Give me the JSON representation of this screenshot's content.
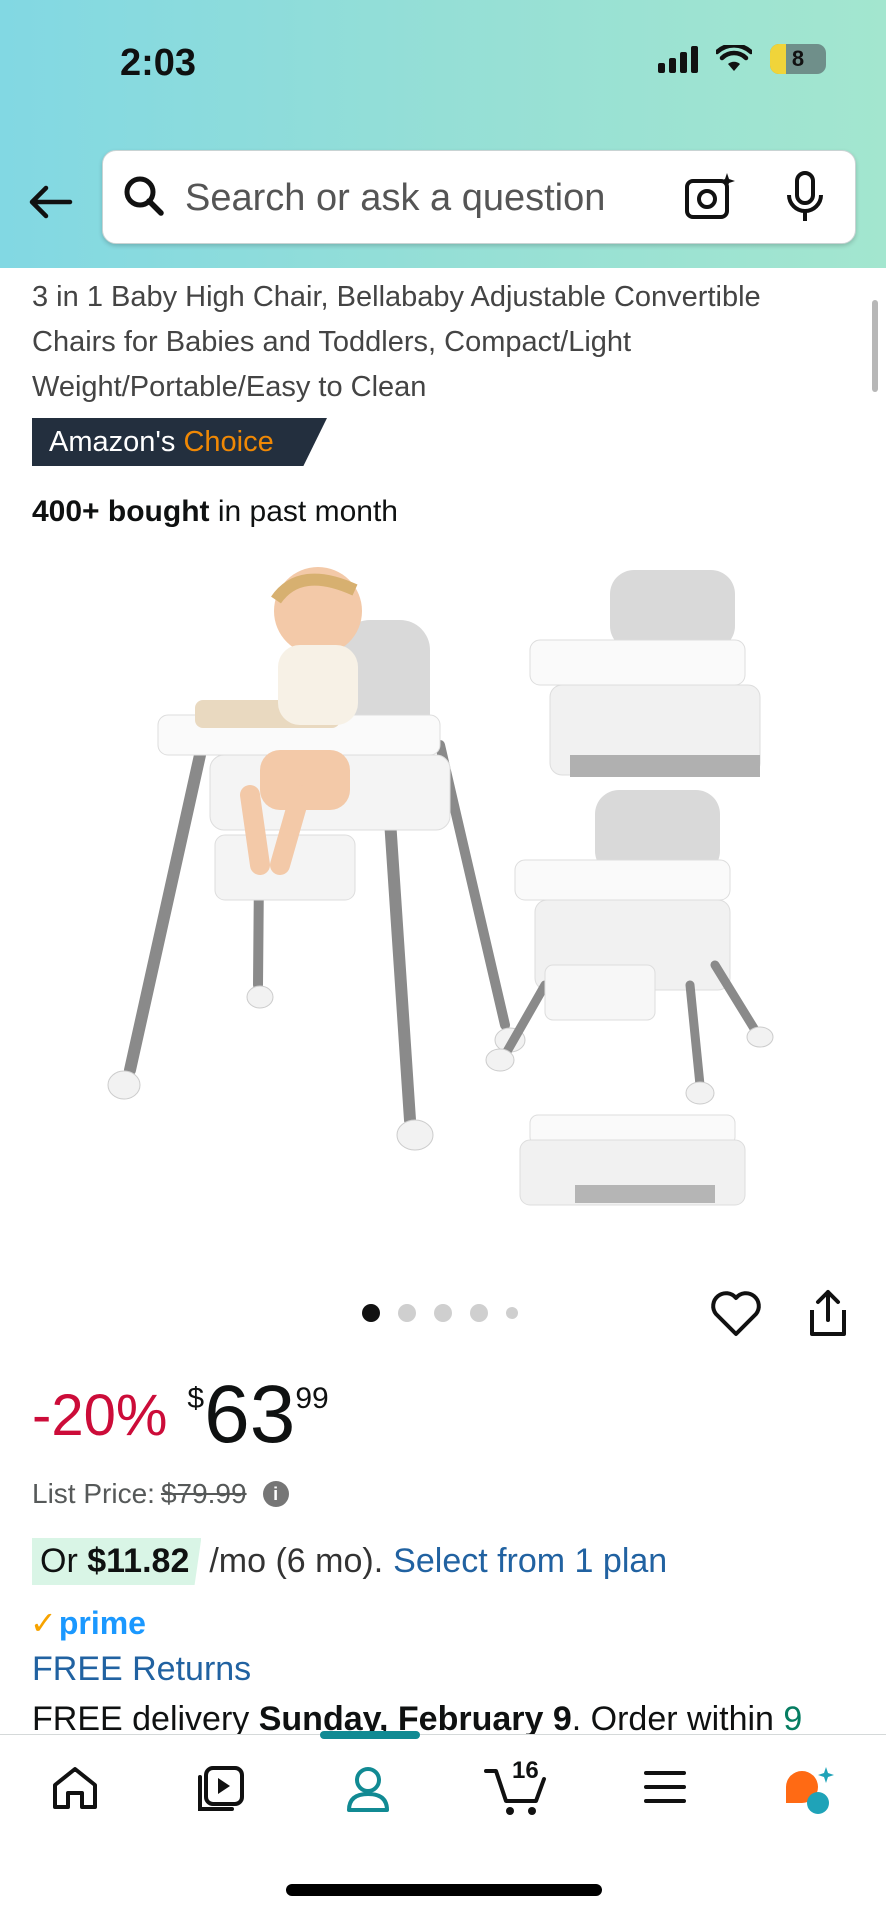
{
  "status_bar": {
    "time": "2:03",
    "battery": "8"
  },
  "search": {
    "placeholder": "Search or ask a question"
  },
  "product": {
    "title": "3 in 1 Baby High Chair, Bellababy Adjustable Convertible Chairs for Babies and Toddlers, Compact/Light Weight/Portable/Easy to Clean",
    "badge_prefix": "Amazon's",
    "badge_choice": "Choice",
    "bought_bold": "400+ bought",
    "bought_rest": "in past month",
    "gallery_dots": 5,
    "gallery_active": 1
  },
  "price": {
    "discount": "-20%",
    "currency": "$",
    "whole": "63",
    "fraction": "99",
    "list_label": "List Price:",
    "list_value": "$79.99"
  },
  "plan": {
    "prefix": "Or",
    "amount": "$11.82",
    "rest": "/mo (6 mo).",
    "link": "Select from 1 plan"
  },
  "prime": {
    "check": "✓",
    "label": "prime"
  },
  "returns": "FREE Returns",
  "delivery": {
    "prefix": "FREE delivery",
    "date": "Sunday, February 9",
    "middle": ". Order within",
    "countdown": "9"
  },
  "nav": {
    "cart_count": "16"
  },
  "colors": {
    "accent": "#118a93",
    "link": "#2162a1",
    "discount": "#cc0c39"
  }
}
